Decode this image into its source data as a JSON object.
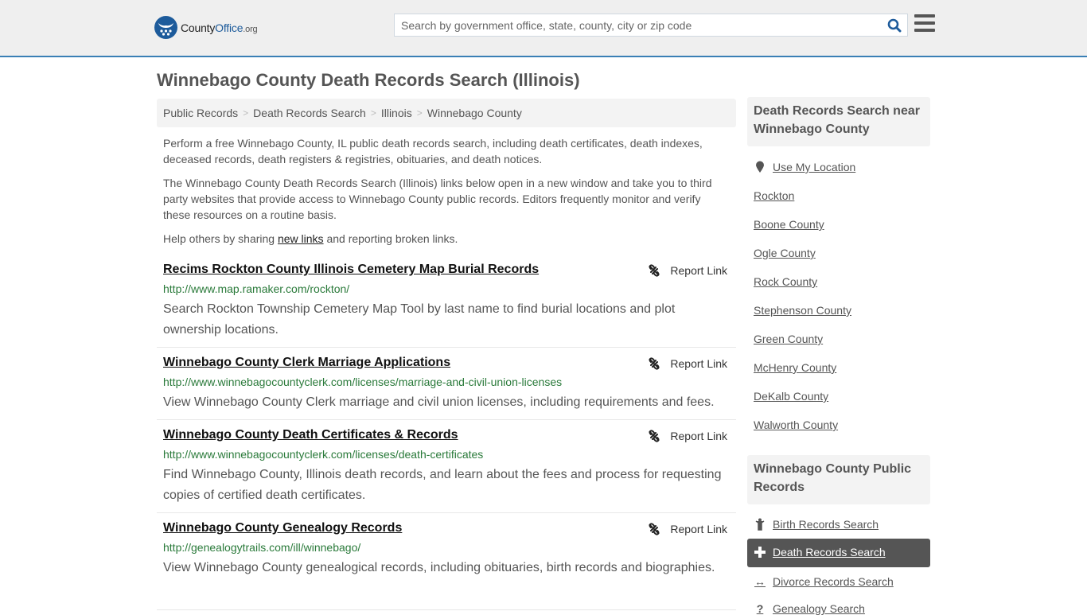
{
  "header": {
    "logo": {
      "county": "County",
      "office": "Office",
      "org": ".org"
    },
    "search_placeholder": "Search by government office, state, county, city or zip code",
    "search_icon": "search-icon",
    "menu_icon": "hamburger-menu-icon"
  },
  "page_title": "Winnebago County Death Records Search (Illinois)",
  "breadcrumb": [
    "Public Records",
    "Death Records Search",
    "Illinois",
    "Winnebago County"
  ],
  "intro": {
    "p1": "Perform a free Winnebago County, IL public death records search, including death certificates, death indexes, deceased records, death registers & registries, obituaries, and death notices.",
    "p2": "The Winnebago County Death Records Search (Illinois) links below open in a new window and take you to third party websites that provide access to Winnebago County public records. Editors frequently monitor and verify these resources on a routine basis.",
    "p3_before": "Help others by sharing ",
    "p3_link": "new links",
    "p3_after": " and reporting broken links."
  },
  "report_label": "Report Link",
  "results": [
    {
      "title": "Recims Rockton County Illinois Cemetery Map Burial Records",
      "url": "http://www.map.ramaker.com/rockton/",
      "desc": "Search Rockton Township Cemetery Map Tool by last name to find burial locations and plot ownership locations."
    },
    {
      "title": "Winnebago County Clerk Marriage Applications",
      "url": "http://www.winnebagocountyclerk.com/licenses/marriage-and-civil-union-licenses",
      "desc": "View Winnebago County Clerk marriage and civil union licenses, including requirements and fees."
    },
    {
      "title": "Winnebago County Death Certificates & Records",
      "url": "http://www.winnebagocountyclerk.com/licenses/death-certificates",
      "desc": "Find Winnebago County, Illinois death records, and learn about the fees and process for requesting copies of certified death certificates."
    },
    {
      "title": "Winnebago County Genealogy Records",
      "url": "http://genealogytrails.com/ill/winnebago/",
      "desc": "View Winnebago County genealogical records, including obituaries, birth records and biographies."
    }
  ],
  "sidebar": {
    "nearby_title": "Death Records Search near Winnebago County",
    "use_location": "Use My Location",
    "nearby": [
      "Rockton",
      "Boone County",
      "Ogle County",
      "Rock County",
      "Stephenson County",
      "Green County",
      "McHenry County",
      "DeKalb County",
      "Walworth County"
    ],
    "public_title": "Winnebago County Public Records",
    "public_links": [
      {
        "label": "Birth Records Search",
        "icon": "child-icon",
        "active": false
      },
      {
        "label": "Death Records Search",
        "icon": "plus-cross-icon",
        "active": true
      },
      {
        "label": "Divorce Records Search",
        "icon": "arrows-horizontal-icon",
        "active": false
      },
      {
        "label": "Genealogy Search",
        "icon": "question-icon",
        "active": false
      }
    ]
  },
  "colors": {
    "accent": "#1d5b9b",
    "header_border": "#3a7fb5",
    "url_green": "#2a7a3a",
    "active_bg": "#555555"
  }
}
